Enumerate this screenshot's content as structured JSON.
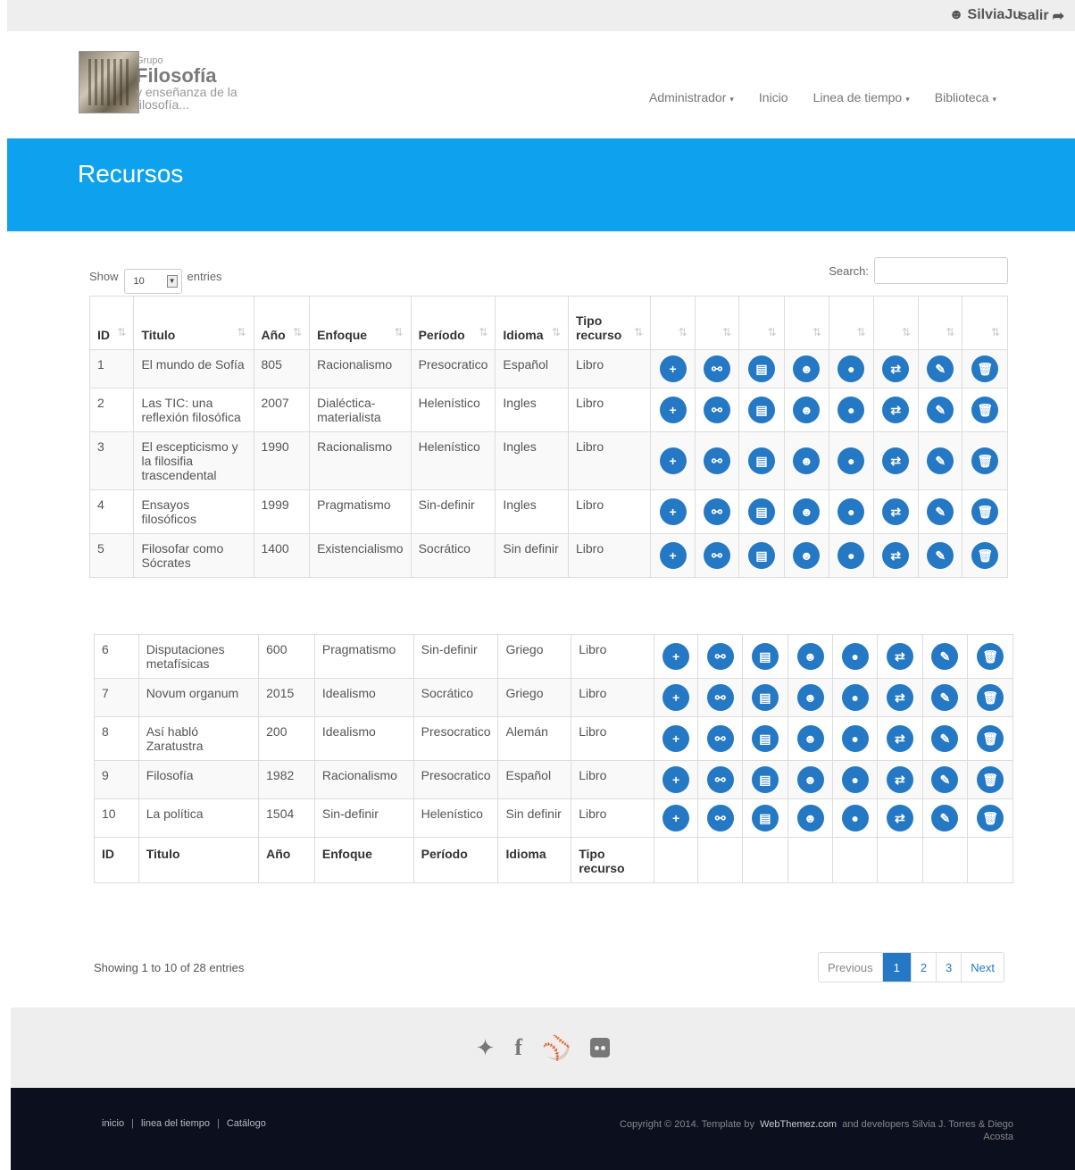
{
  "topbar": {
    "user": "SilviaJu",
    "logout": "salir"
  },
  "logo": {
    "grupo": "Grupo",
    "name": "Filosofía",
    "line2": "y enseñanza de la",
    "line3": "filosofía..."
  },
  "nav": [
    "Administrador",
    "Inicio",
    "Linea de tiempo",
    "Biblioteca"
  ],
  "banner": {
    "title": "Recursos"
  },
  "controls": {
    "show": "Show",
    "entries_value": "10",
    "entries": "entries",
    "search": "Search:"
  },
  "table": {
    "headers": [
      "ID",
      "Titulo",
      "Año",
      "Enfoque",
      "Período",
      "Idioma",
      "Tipo recurso"
    ],
    "rows": [
      [
        "1",
        "El mundo de Sofía",
        "805",
        "Racionalismo",
        "Presocratico",
        "Español",
        "Libro"
      ],
      [
        "2",
        "Las TIC: una reflexión filosófica",
        "2007",
        "Dialéctica-materialista",
        "Helenístico",
        "Ingles",
        "Libro"
      ],
      [
        "3",
        "El escepticismo y la filosifia trascendental",
        "1990",
        "Racionalismo",
        "Helenístico",
        "Ingles",
        "Libro"
      ],
      [
        "4",
        "Ensayos filosóficos",
        "1999",
        "Pragmatismo",
        "Sin-definir",
        "Ingles",
        "Libro"
      ],
      [
        "5",
        "Filosofar como Sócrates",
        "1400",
        "Existencialismo",
        "Socrático",
        "Sin definir",
        "Libro"
      ],
      [
        "6",
        "Disputaciones metafísicas",
        "600",
        "Pragmatismo",
        "Sin-definir",
        "Griego",
        "Libro"
      ],
      [
        "7",
        "Novum organum",
        "2015",
        "Idealismo",
        "Socrático",
        "Griego",
        "Libro"
      ],
      [
        "8",
        "Así habló Zaratustra",
        "200",
        "Idealismo",
        "Presocratico",
        "Alemán",
        "Libro"
      ],
      [
        "9",
        "Filosofía",
        "1982",
        "Racionalismo",
        "Presocratico",
        "Español",
        "Libro"
      ],
      [
        "10",
        "La política",
        "1504",
        "Sin-definir",
        "Helenístico",
        "Sin definir",
        "Libro"
      ]
    ],
    "action_icons": [
      "plus-icon",
      "link-icon",
      "book-icon",
      "group-icon",
      "comment-icon",
      "exchange-icon",
      "wrench-icon",
      "trash-icon"
    ],
    "action_glyphs": [
      "+",
      "⚯",
      "▤",
      "☻",
      "●",
      "⇄",
      "✎",
      "🗑"
    ],
    "accent": "#2478c4"
  },
  "info": "Showing 1 to 10 of 28 entries",
  "pager": {
    "prev": "Previous",
    "pages": [
      "1",
      "2",
      "3"
    ],
    "next": "Next"
  },
  "footer": {
    "links": [
      "inicio",
      "linea del tiempo",
      "Catálogo"
    ],
    "copy_pre": "Copyright © 2014. Template by",
    "brand": "WebThemez.com",
    "copy_post": "and developers Silvia J. Torres & Diego Acosta"
  },
  "banner_color": "#0ea2ee"
}
